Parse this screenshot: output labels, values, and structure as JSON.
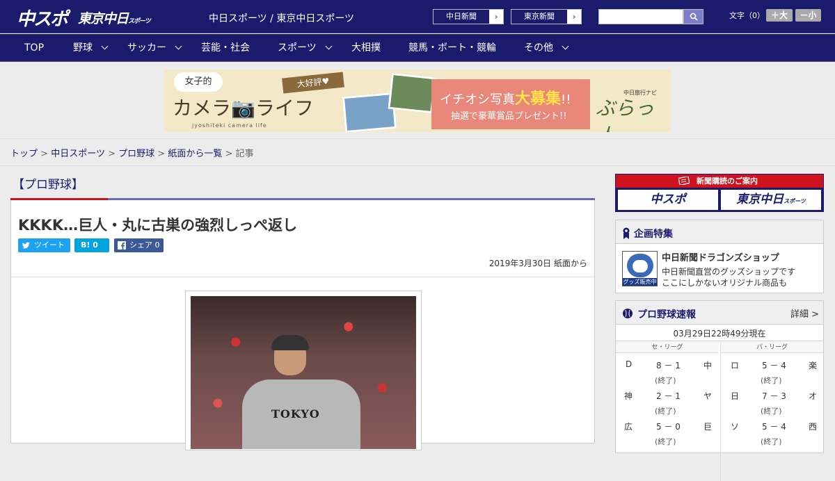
{
  "header": {
    "logo_main": "中スポ",
    "logo_tokyo": "東京中日",
    "logo_tokyo_small": "スポーツ",
    "site_name": "中日スポーツ / 東京中日スポーツ",
    "link_chunichi": "中日新聞",
    "link_tokyo": "東京新聞",
    "search_placeholder": "",
    "font_size_label": "文字（0）",
    "font_bigger": "＋大",
    "font_smaller": "－小"
  },
  "nav": [
    "TOP",
    "野球",
    "サッカー",
    "芸能・社会",
    "スポーツ",
    "大相撲",
    "競馬・ボート・競輪",
    "その他"
  ],
  "ad": {
    "bubble": "女子的",
    "title": "カメラ📷ライフ",
    "subtitle": "jyoshiteki camera life",
    "badge": "大好評♥",
    "headline_pre": "イチオシ写真",
    "headline_bold": "大募集",
    "headline_post": "!!",
    "sub": "抽選で豪華賞品プレゼント!!",
    "brand": "ぶらっ人",
    "brand_small": "中日旅行ナビ"
  },
  "breadcrumb": {
    "items": [
      "トップ",
      "中日スポーツ",
      "プロ野球",
      "紙面から一覧"
    ],
    "current": "記事",
    "sep": ">"
  },
  "article": {
    "category": "【プロ野球】",
    "title": "KKKK…巨人・丸に古巣の強烈しっぺ返し",
    "tweet": "ツイート",
    "hatena": "B! 0",
    "share": "シェア 0",
    "date": "2019年3月30日 紙面から",
    "photo_text": "TOKYO"
  },
  "sidebar": {
    "subscribe_header": "新聞購読のご案内",
    "sub_logo1": "中スポ",
    "sub_logo2": "東京中日",
    "sub_logo2_small": "スポーツ",
    "feature_title": "企画特集",
    "shop_label": "グッズ販売中",
    "shop_name": "中日新聞ドラゴンズショップ",
    "shop_desc1": "中日新聞直営のグッズショップです",
    "shop_desc2": "ここにしかないオリジナル商品も",
    "scores_title": "プロ野球速報",
    "scores_more": "詳細 >",
    "updated": "03月29日22時49分現在",
    "league_central": "セ・リーグ",
    "league_pacific": "パ・リーグ",
    "central": [
      {
        "home": "D",
        "score": "8 － 1",
        "away": "中",
        "status": "(終了)"
      },
      {
        "home": "神",
        "score": "2 － 1",
        "away": "ヤ",
        "status": "(終了)"
      },
      {
        "home": "広",
        "score": "5 － 0",
        "away": "巨",
        "status": "(終了)"
      }
    ],
    "pacific": [
      {
        "home": "ロ",
        "score": "5 － 4",
        "away": "楽",
        "status": "(終了)"
      },
      {
        "home": "日",
        "score": "7 － 3",
        "away": "オ",
        "status": "(終了)"
      },
      {
        "home": "ソ",
        "score": "5 － 4",
        "away": "西",
        "status": "(終了)"
      }
    ]
  },
  "colors": {
    "brand_navy": "#1b1b6e",
    "accent_red": "#d0121e",
    "twitter": "#1da1f2",
    "hatena": "#00a4de",
    "facebook": "#3b5998"
  }
}
